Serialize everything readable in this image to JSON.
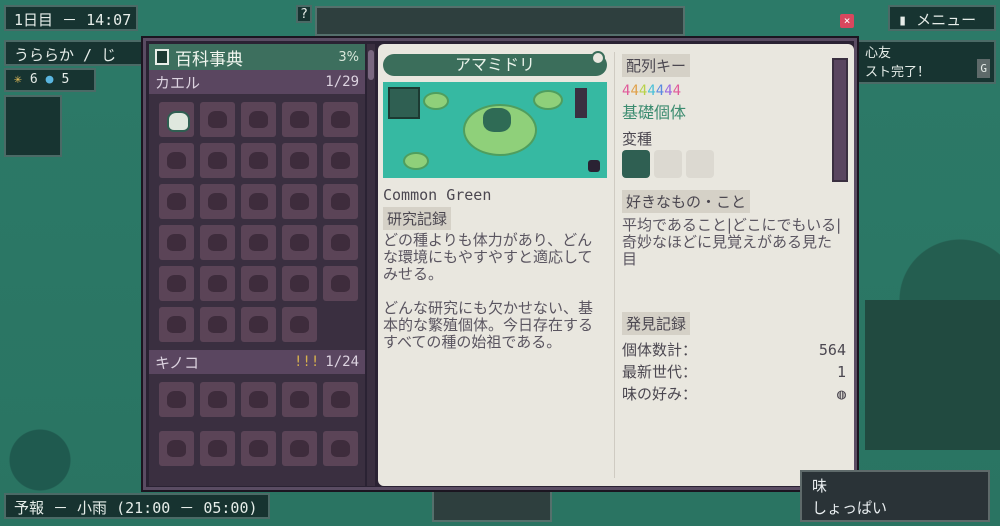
{
  "hud": {
    "date_time": "1日目 － 14:07",
    "weather": "うららか / じ",
    "resources": [
      "6",
      "5"
    ],
    "forecast": "予報 － 小雨 (21:00 － 05:00)",
    "menu_label": "メニュー",
    "notice_line1": "心友",
    "notice_line2": "スト完了！",
    "notice_key": "G",
    "help_key": "?"
  },
  "encyclopedia": {
    "title": "百科事典",
    "percent": "3%",
    "sections": [
      {
        "name": "カエル",
        "count": "1/29"
      },
      {
        "name": "キノコ",
        "count": "1/24"
      }
    ]
  },
  "entry": {
    "name_jp": "アマミドリ",
    "name_en": "Common Green",
    "research_label": "研究記録",
    "research_p1": "どの種よりも体力があり、どんな環境にもやすやすと適応してみせる。",
    "research_p2": "どんな研究にも欠かせない、基本的な繁殖個体。今日存在するすべての種の始祖である。",
    "sequence_label": "配列キー",
    "sequence_key": "4444444",
    "base_label": "基礎個体",
    "variant_label": "変種",
    "likes_label": "好きなもの・こと",
    "likes_text": "平均であること|どこにでもいる|奇妙なほどに見覚えがある見た目",
    "discovery_label": "発見記録",
    "stats": [
      {
        "label": "個体数計：",
        "value": "564"
      },
      {
        "label": "最新世代：",
        "value": "1"
      },
      {
        "label": "味の好み：",
        "value": ""
      }
    ]
  },
  "tooltip": {
    "title": "味",
    "text": "しょっぱい"
  },
  "colors": {
    "key_digits": [
      "#e05a9a",
      "#e0a14a",
      "#b8d24a",
      "#4ac0d8",
      "#5a8ae0",
      "#9a6ae0",
      "#e05a9a"
    ]
  }
}
